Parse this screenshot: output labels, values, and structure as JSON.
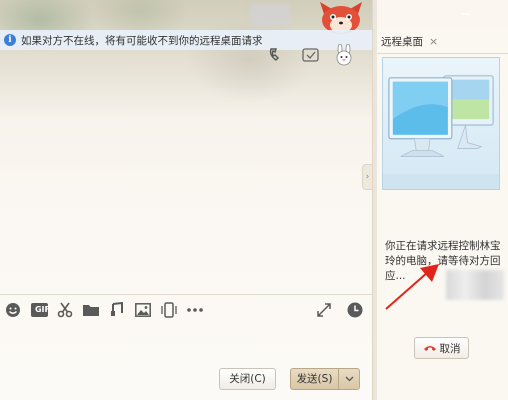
{
  "notification": {
    "icon": "info-icon",
    "text": "如果对方不在线，将有可能收不到你的远程桌面请求"
  },
  "toolbar": {
    "items": [
      "emoji-icon",
      "gif-icon",
      "screenshot-icon",
      "folder-icon",
      "music-icon",
      "image-icon",
      "shake-icon",
      "more-icon"
    ],
    "gif_label": "GIF",
    "right_items": [
      "expand-icon",
      "history-icon"
    ]
  },
  "buttons": {
    "close_label": "关闭(C)",
    "send_label": "发送(S)",
    "cancel_label": "取消"
  },
  "right_panel": {
    "tab_label": "远程桌面",
    "tab_close": "×",
    "status_text": "你正在请求远程控制林宝玲的电脑，请等待对方回应..."
  },
  "colors": {
    "accent_blue": "#3e7fd6",
    "annotation_red": "#e0261c",
    "hangup_red": "#d9412f",
    "send_button": "#dccba9"
  }
}
